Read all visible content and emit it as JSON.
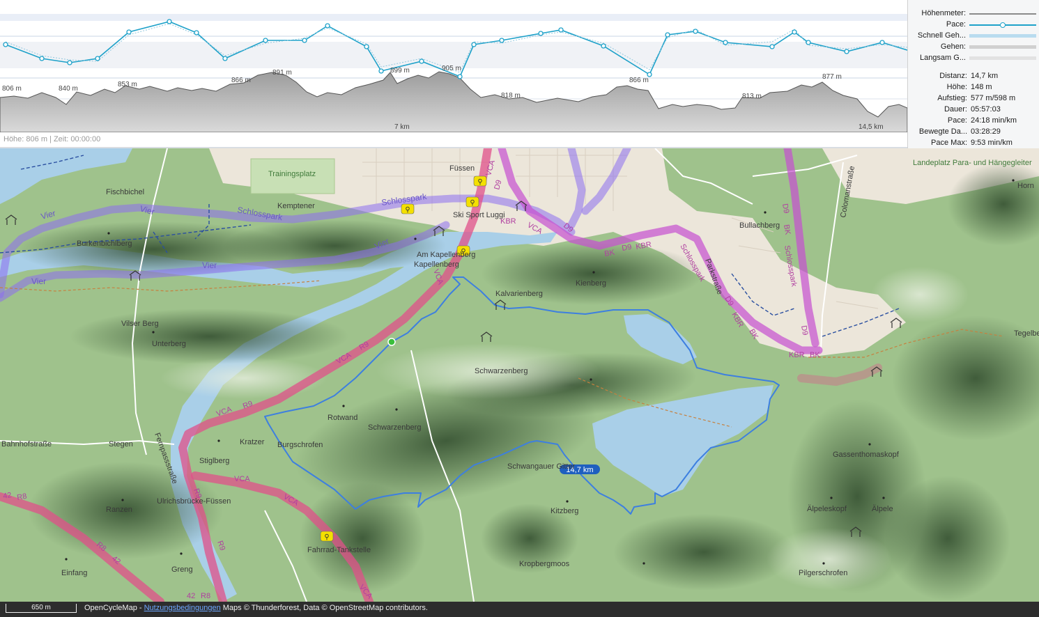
{
  "chart": {
    "elevation_labels": [
      "806 m",
      "840 m",
      "853 m",
      "866 m",
      "891 m",
      "899 m",
      "905 m",
      "818 m",
      "866 m",
      "813 m",
      "877 m"
    ],
    "distance_labels": [
      "7 km",
      "14,5 km"
    ],
    "status": "Höhe: 806 m | Zeit: 00:00:00",
    "pace_color": "#1da1c9",
    "elevation_fill": "#bdbdbd"
  },
  "legend": {
    "items": [
      {
        "label": "Höhenmeter:",
        "color": "#8a8a8a"
      },
      {
        "label": "Pace:",
        "color": "#1da1c9"
      },
      {
        "label": "Schnell Geh...",
        "color": "#b9dcef"
      },
      {
        "label": "Gehen:",
        "color": "#d0d0d0"
      },
      {
        "label": "Langsam G...",
        "color": "#e2e2e2"
      }
    ]
  },
  "stats": {
    "rows": [
      {
        "label": "Distanz:",
        "value": "14,7 km"
      },
      {
        "label": "Höhe:",
        "value": "148 m"
      },
      {
        "label": "Aufstieg:",
        "value": "577 m/598 m"
      },
      {
        "label": "Dauer:",
        "value": "05:57:03"
      },
      {
        "label": "Pace:",
        "value": "24:18 min/km"
      },
      {
        "label": "Bewegte Da...",
        "value": "03:28:29"
      },
      {
        "label": "Pace Max:",
        "value": "9:53 min/km"
      }
    ]
  },
  "map": {
    "places": [
      "Füssen",
      "Fischbichel",
      "Trainingsplatz",
      "Burkenbichlberg",
      "Kapellenberg",
      "Kalvarienberg",
      "Kienberg",
      "Bullachberg",
      "Vilser Berg",
      "Unterberg",
      "Schwarzenberg",
      "Rotwand",
      "Kratzer",
      "Burgschrofen",
      "Stiglberg",
      "Ulrichsbrücke-Füssen",
      "Ranzen",
      "Einfang",
      "Greng",
      "Schwangauer Gitter",
      "Kitzberg",
      "Kropbergmoos",
      "Gassenthomaskopf",
      "Älpeleskopf",
      "Älpele",
      "Pilgerschrofen",
      "Tegelberg",
      "Horn",
      "Landeplatz Para- und Hängegleiter",
      "Ski Sport Luggi",
      "Fahrrad-Tankstelle",
      "Am Kapellenberg",
      "Stegen",
      "Bahnhofstraße",
      "Fernpassstraße",
      "Colomanstraße",
      "Parkstraße",
      "Kemptener"
    ],
    "route_badge": "14,7 km",
    "route_color": "#3d7fe0",
    "cycle_routes": [
      "VCA",
      "R9",
      "D9",
      "KBR",
      "BK",
      "Schlosspark",
      "Vier",
      "R8",
      "42"
    ]
  },
  "footer": {
    "scale": "650 m",
    "attribution_prefix": "OpenCycleMap - ",
    "terms_link": "Nutzungsbedingungen",
    "attribution_suffix": " Maps © Thunderforest, Data © OpenStreetMap contributors."
  }
}
